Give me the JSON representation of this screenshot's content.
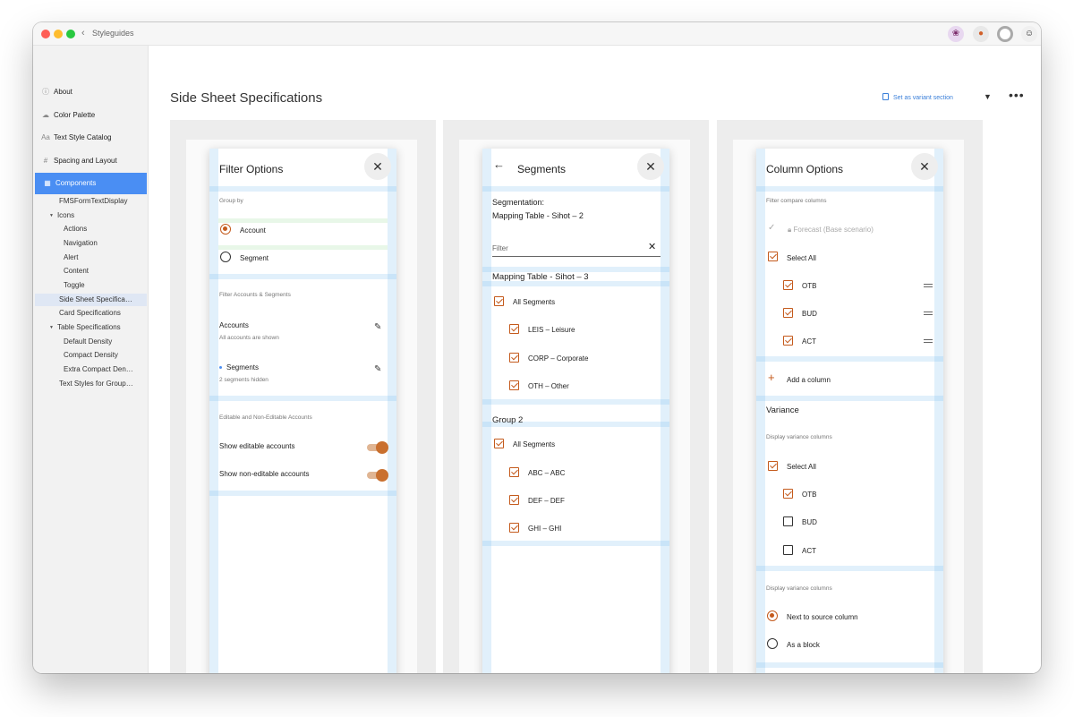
{
  "window": {
    "title": "Styleguides"
  },
  "sidebar": {
    "items": [
      {
        "label": "About",
        "icon": "info-icon"
      },
      {
        "label": "Color Palette",
        "icon": "cloud-icon"
      },
      {
        "label": "Text Style Catalog",
        "icon": "text-aa-icon",
        "icon_text": "Aa"
      },
      {
        "label": "Spacing and Layout",
        "icon": "grid-ruler-icon"
      },
      {
        "label": "Components",
        "icon": "components-grid-icon",
        "active": true
      }
    ],
    "children": [
      "FMSFormTextDisplay",
      "Icons",
      "Actions",
      "Navigation",
      "Alert",
      "Content",
      "Toggle",
      "Side Sheet Specifica…",
      "Card Specifications",
      "Table Specifications",
      "Default Density",
      "Compact Density",
      "Extra Compact Den…",
      "Text Styles for Group…"
    ]
  },
  "main": {
    "title": "Side Sheet Specifications",
    "variant_button": "Set as variant section"
  },
  "sheet1": {
    "title": "Filter Options",
    "group_by_label": "Group by",
    "radio_account": "Account",
    "radio_segment": "Segment",
    "filter_section": "Filter Accounts & Segments",
    "accounts_title": "Accounts",
    "accounts_sub": "All accounts are shown",
    "segments_title": "Segments",
    "segments_sub": "2 segments hidden",
    "editable_section": "Editable and Non-Editable Accounts",
    "toggle1": "Show editable accounts",
    "toggle2": "Show non-editable accounts"
  },
  "sheet2": {
    "title": "Segments",
    "seg_line1": "Segmentation:",
    "seg_line2": "Mapping Table - Sihot – 2",
    "filter_placeholder": "Filter",
    "group1_title": "Mapping Table - Sihot – 3",
    "group1_all": "All Segments",
    "group1_items": [
      "LEIS – Leisure",
      "CORP – Corporate",
      "OTH – Other"
    ],
    "group2_title": "Group 2",
    "group2_all": "All Segments",
    "group2_items": [
      "ABC – ABC",
      "DEF – DEF",
      "GHI – GHI"
    ]
  },
  "sheet3": {
    "title": "Column Options",
    "compare_section": "Filter compare columns",
    "forecast": "Forecast (Base scenario)",
    "select_all": "Select All",
    "compare_items": [
      "OTB",
      "BUD",
      "ACT"
    ],
    "add_column": "Add a column",
    "variance_title": "Variance",
    "variance_section": "Display variance columns",
    "variance_select_all": "Select All",
    "variance_items": [
      "OTB",
      "BUD",
      "ACT"
    ],
    "display_section": "Display variance columns",
    "radio_next": "Next to source column",
    "radio_block": "As a block"
  },
  "colors": {
    "accent": "#c45a1c",
    "sidebar_active": "#4a8ef3",
    "link": "#3a7fd9"
  }
}
